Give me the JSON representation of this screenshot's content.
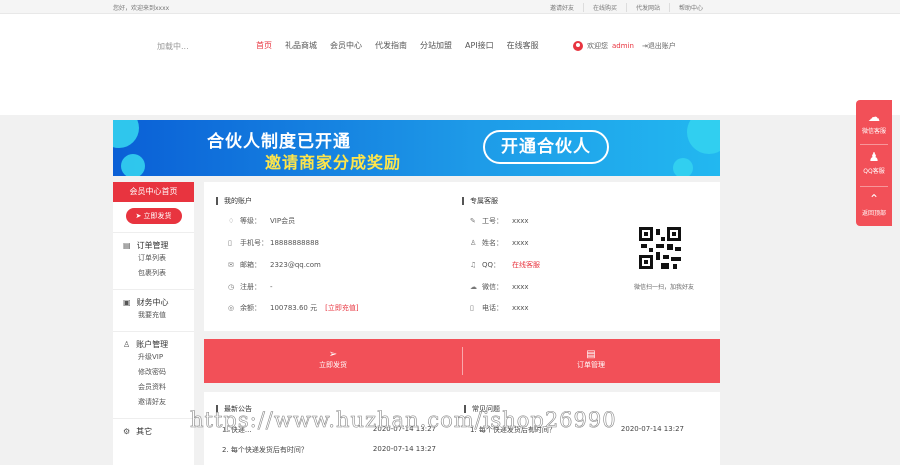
{
  "topbar": {
    "welcome": "您好，欢迎来到xxxx",
    "links": [
      "邀请好友",
      "在线购买",
      "代发网站",
      "帮助中心"
    ]
  },
  "header": {
    "logo": "加载中...",
    "nav": [
      "首页",
      "礼品商城",
      "会员中心",
      "代发指南",
      "分站加盟",
      "API接口",
      "在线客服"
    ],
    "greeting": "欢迎您",
    "username": "admin",
    "logout": "退出账户"
  },
  "banner": {
    "line1": "合伙人制度已开通",
    "line2": "邀请商家分成奖励",
    "cta": "开通合伙人"
  },
  "sidebar": {
    "title": "会员中心首页",
    "send_button": "立即发货",
    "groups": [
      {
        "title": "订单管理",
        "icon": "clipboard-icon",
        "items": [
          "订单列表",
          "包裹列表"
        ]
      },
      {
        "title": "财务中心",
        "icon": "ledger-icon",
        "items": [
          "我要充值"
        ]
      },
      {
        "title": "账户管理",
        "icon": "users-icon",
        "items": [
          "升级VIP",
          "修改密码",
          "会员资料",
          "邀请好友"
        ]
      },
      {
        "title": "其它",
        "icon": "gear-icon",
        "items": []
      }
    ]
  },
  "account": {
    "title": "我的账户",
    "rows": [
      {
        "icon": "badge-icon",
        "label": "等级：",
        "value": "VIP会员"
      },
      {
        "icon": "phone-icon",
        "label": "手机号：",
        "value": "18888888888"
      },
      {
        "icon": "mail-icon",
        "label": "邮箱：",
        "value": "2323@qq.com"
      },
      {
        "icon": "calendar-icon",
        "label": "注册：",
        "value": "-"
      },
      {
        "icon": "coin-icon",
        "label": "余额：",
        "value": "100783.60 元",
        "link": "[立即充值]"
      }
    ]
  },
  "service": {
    "title": "专属客服",
    "rows": [
      {
        "icon": "id-icon",
        "label": "工号：",
        "value": "xxxx"
      },
      {
        "icon": "person-icon",
        "label": "姓名：",
        "value": "xxxx"
      },
      {
        "icon": "bell-icon",
        "label": "QQ：",
        "value": "在线客服",
        "red": true
      },
      {
        "icon": "wechat-icon",
        "label": "微信：",
        "value": "xxxx"
      },
      {
        "icon": "mobile-icon",
        "label": "电话：",
        "value": "xxxx"
      }
    ],
    "qr_caption": "微信扫一扫，加我好友"
  },
  "actions": {
    "left": "立即发货",
    "right": "订单管理"
  },
  "notice": {
    "title": "最新公告",
    "items": [
      {
        "text": "1. 快递...",
        "date": "2020-07-14 13:27"
      },
      {
        "text": "2. 每个快递发货后有时间？",
        "date": "2020-07-14 13:27"
      }
    ]
  },
  "faq": {
    "title": "常见问题",
    "items": [
      {
        "text": "1. 每个快递发货后有时间？",
        "date": "2020-07-14 13:27"
      }
    ]
  },
  "float_bar": {
    "items": [
      "微信客服",
      "QQ客服",
      "返回顶部"
    ]
  },
  "watermark": "https://www.huzhan.com/ishop26990",
  "colors": {
    "accent": "#e8343f",
    "action_bar": "#f25058",
    "banner_from": "#0a5fd6",
    "banner_to": "#22b8f0",
    "banner_highlight": "#ffe54a"
  }
}
